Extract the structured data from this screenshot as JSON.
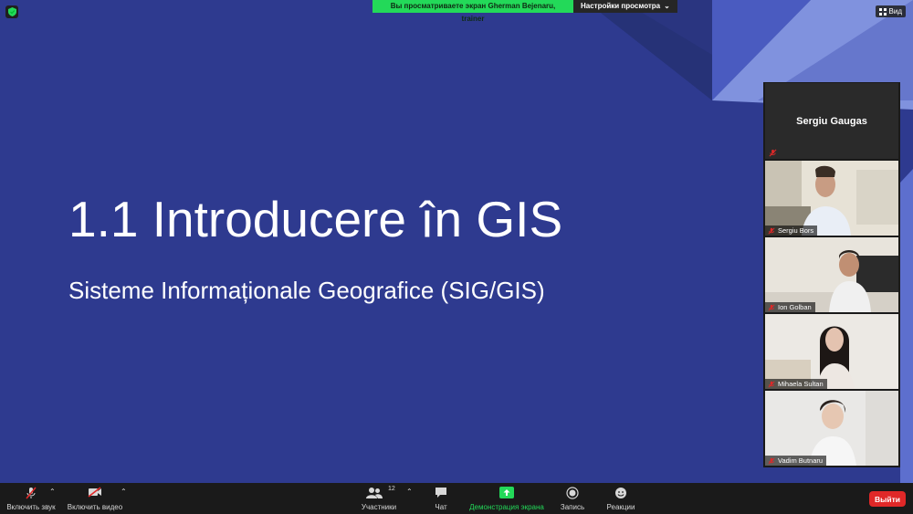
{
  "banner": {
    "viewing_text": "Вы просматриваете экран Gherman Bejenaru, trainer",
    "view_options": "Настройки просмотра"
  },
  "view_button": "Вид",
  "slide": {
    "title": "1.1 Introducere în GIS",
    "subtitle": "Sisteme Informaționale Geografice (SIG/GIS)"
  },
  "speaker": {
    "name": "Sergiu Gaugas"
  },
  "participants": [
    {
      "name": "Sergiu Bors"
    },
    {
      "name": "Ion Golban"
    },
    {
      "name": "Mihaela Sultan"
    },
    {
      "name": "Vadim Butnaru"
    }
  ],
  "toolbar": {
    "unmute": "Включить звук",
    "video": "Включить видео",
    "participants": "Участники",
    "participants_count": "12",
    "chat": "Чат",
    "share": "Демонстрация экрана",
    "record": "Запись",
    "reactions": "Реакции",
    "leave": "Выйти"
  },
  "colors": {
    "slide_bg": "#2e3a8f",
    "share_green": "#23d959",
    "leave_red": "#e02828"
  }
}
